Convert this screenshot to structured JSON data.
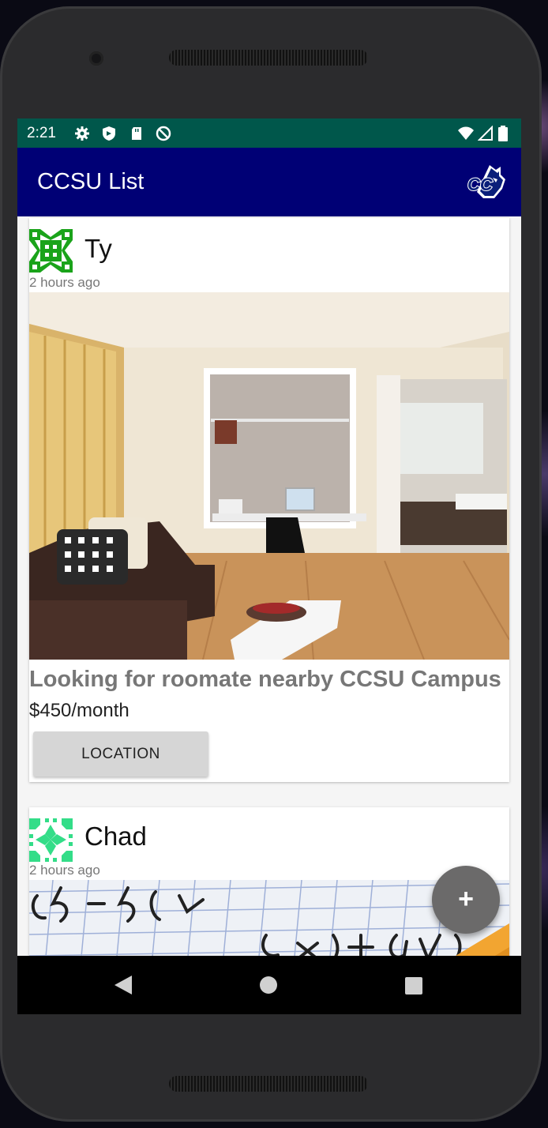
{
  "status_bar": {
    "time": "2:21",
    "icons": [
      "settings-icon",
      "shield-icon",
      "sd-card-icon",
      "no-disturb-icon",
      "wifi-icon",
      "signal-icon",
      "battery-icon"
    ]
  },
  "app_bar": {
    "title": "CCSU List",
    "logo": "ccsu-blue-devils-logo"
  },
  "posts": [
    {
      "user": "Ty",
      "time_ago": "2 hours ago",
      "title": "Looking for roomate nearby CCSU Campus",
      "price": "$450/month",
      "button_label": "LOCATION",
      "avatar_color": "#1aa31a"
    },
    {
      "user": "Chad",
      "time_ago": "2 hours ago",
      "avatar_color": "#33dd88"
    }
  ],
  "fab": {
    "label": "+"
  },
  "colors": {
    "status_bar": "#00574b",
    "app_bar": "#000075"
  }
}
